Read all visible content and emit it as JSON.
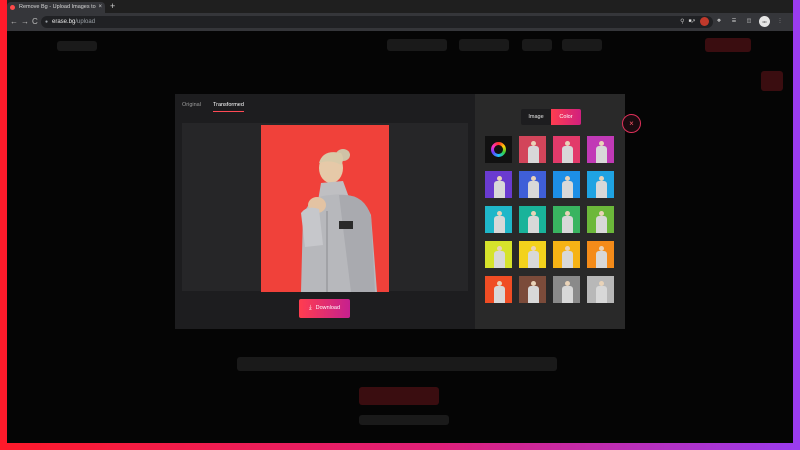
{
  "browser": {
    "tab_title": "Remove Bg - Upload Images to",
    "tab_close": "×",
    "new_tab": "+",
    "back": "←",
    "forward": "→",
    "reload": "C",
    "url_host": "erase.bg",
    "url_path": "/upload"
  },
  "modal": {
    "tabs": [
      "Original",
      "Transformed"
    ],
    "active_tab": "Transformed",
    "download_label": "Download",
    "close_icon": "×",
    "mode_tabs": [
      "Image",
      "Color"
    ],
    "active_mode": "Color",
    "swatch_colors": [
      "#d2455a",
      "#e23a6a",
      "#c13ab6",
      "#6a3bd0",
      "#3f5fd8",
      "#1d8fe6",
      "#1fa3e2",
      "#1fb7c9",
      "#19b39a",
      "#39b460",
      "#6cb83a",
      "#d6e32b",
      "#f3d21c",
      "#f6b315",
      "#f48b19",
      "#f04d24",
      "#7b4b3a",
      "#8a8a8a",
      "#b8b8b8"
    ],
    "bottom_swatches": [
      "#7a95b0",
      "#000000",
      "#ffffff"
    ],
    "preview_background": "#f0413a"
  }
}
